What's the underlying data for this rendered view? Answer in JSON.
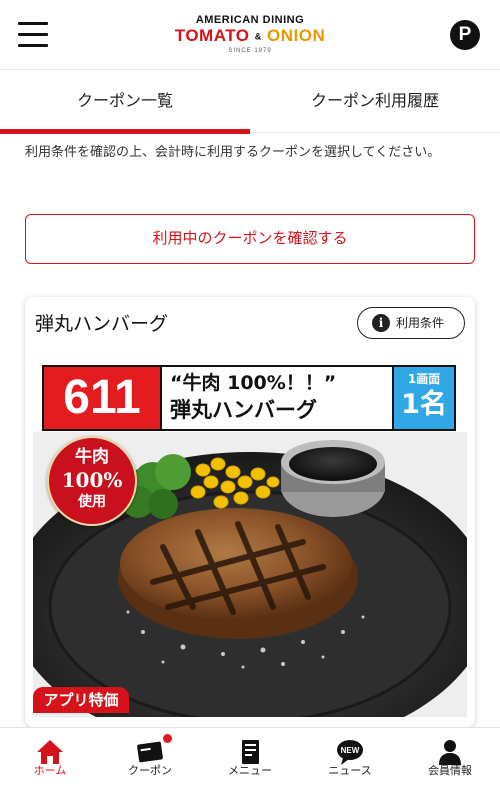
{
  "header": {
    "logo_top": "AMERICAN DINING",
    "logo_part1": "TOMATO",
    "logo_amp": "&",
    "logo_part2": "ONION",
    "logo_since": "SINCE 1979",
    "point_label": "P"
  },
  "tabs": [
    {
      "label": "クーポン一覧",
      "active": true
    },
    {
      "label": "クーポン利用履歴",
      "active": false
    }
  ],
  "notice": "利用条件を確認の上、会計時に利用するクーポンを選択してください。",
  "check_button_label": "利用中のクーポンを確認する",
  "coupon": {
    "title": "弾丸ハンバーグ",
    "terms_label": "利用条件",
    "price": "611",
    "name_line1": "“牛肉 100%！！”",
    "name_line2": "弾丸ハンバーグ",
    "limit_line1": "1画面",
    "limit_line2": "1名",
    "badge_line1": "牛肉",
    "badge_line2": "100%",
    "badge_line3": "使用",
    "app_price_label": "アプリ特価"
  },
  "bottom_nav": [
    {
      "label": "ホーム",
      "icon": "home-icon",
      "active": true
    },
    {
      "label": "クーポン",
      "icon": "coupon-icon",
      "active": false,
      "notification": true
    },
    {
      "label": "メニュー",
      "icon": "menu-book-icon",
      "active": false
    },
    {
      "label": "ニュース",
      "icon": "news-icon",
      "active": false
    },
    {
      "label": "会員情報",
      "icon": "member-icon",
      "active": false
    }
  ],
  "colors": {
    "accent": "#d4141a",
    "price_bg": "#e31c20",
    "limit_bg": "#31a7e6"
  }
}
